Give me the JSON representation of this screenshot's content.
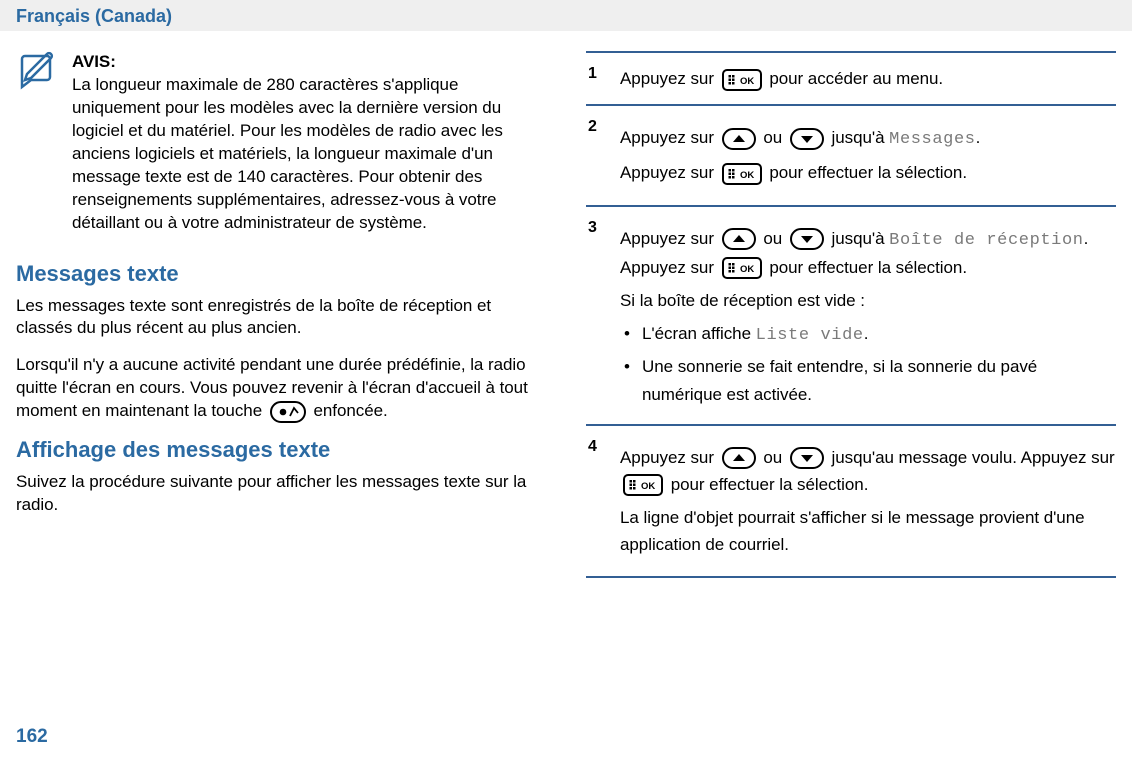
{
  "header": {
    "language": "Français (Canada)"
  },
  "page_number": "162",
  "notice": {
    "title": "AVIS:",
    "body": "La longueur maximale de 280 caractères s'applique uniquement pour les modèles avec la dernière version du logiciel et du matériel. Pour les modèles de radio avec les anciens logiciels et matériels, la longueur maximale d'un message texte est de 140 caractères. Pour obtenir des renseignements supplémentaires, adressez-vous à votre détaillant ou à votre administrateur de système."
  },
  "section1": {
    "title": "Messages texte",
    "p1": "Les messages texte sont enregistrés de la boîte de réception et classés du plus récent au plus ancien.",
    "p2a": "Lorsqu'il n'y a aucune activité pendant une durée prédéfinie, la radio quitte l'écran en cours. Vous pouvez revenir à l'écran d'accueil à tout moment en maintenant la touche ",
    "p2b": " enfoncée."
  },
  "section2": {
    "title": "Affichage des messages texte",
    "p1": "Suivez la procédure suivante pour afficher les messages texte sur la radio."
  },
  "steps": {
    "s1": {
      "a": "Appuyez sur ",
      "b": " pour accéder au menu."
    },
    "s2": {
      "a": "Appuyez sur ",
      "b": " ou ",
      "c": " jusqu'à ",
      "msg": "Messages",
      "d": ".",
      "e": "Appuyez sur ",
      "f": " pour effectuer la sélection."
    },
    "s3": {
      "a": "Appuyez sur ",
      "b": " ou ",
      "c": " jusqu'à ",
      "inbox": "Boîte de réception",
      "d": ". Appuyez sur ",
      "e": " pour effectuer la sélection.",
      "empty_intro": "Si la boîte de réception est vide :",
      "bullet1a": "L'écran affiche ",
      "bullet1b": "Liste vide",
      "bullet1c": ".",
      "bullet2": "Une sonnerie se fait entendre, si la sonnerie du pavé numérique est activée."
    },
    "s4": {
      "a": "Appuyez sur ",
      "b": " ou ",
      "c": " jusqu'au message voulu. Appuyez sur ",
      "d": " pour effectuer la sélection.",
      "e": "La ligne d'objet pourrait s'afficher si le message provient d'une application de courriel."
    }
  }
}
